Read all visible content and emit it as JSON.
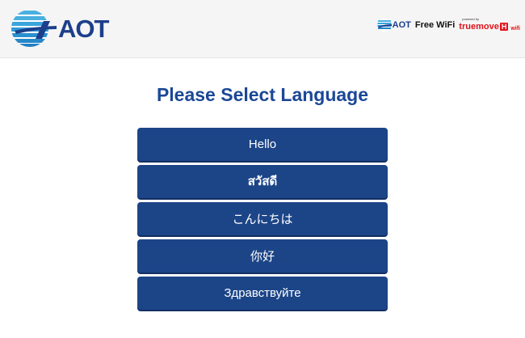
{
  "header": {
    "logo_text": "AOT",
    "wifi_brand": "AOT",
    "wifi_label": "Free WiFi",
    "powered_by": "powered by",
    "partner_name": "truemove",
    "partner_badge": "H",
    "partner_suffix": "wifi"
  },
  "main": {
    "title": "Please Select Language",
    "languages": [
      {
        "label": "Hello"
      },
      {
        "label": "สวัสดี"
      },
      {
        "label": "こんにちは"
      },
      {
        "label": "你好"
      },
      {
        "label": "Здравствуйте"
      }
    ]
  },
  "colors": {
    "brand_blue": "#1c3f8c",
    "button_blue": "#1c4588",
    "title_blue": "#1b4796",
    "truemove_red": "#e3131b"
  },
  "icons": {
    "logo": "aot-airport-logo-icon",
    "mini_logo": "aot-mini-logo-icon"
  }
}
